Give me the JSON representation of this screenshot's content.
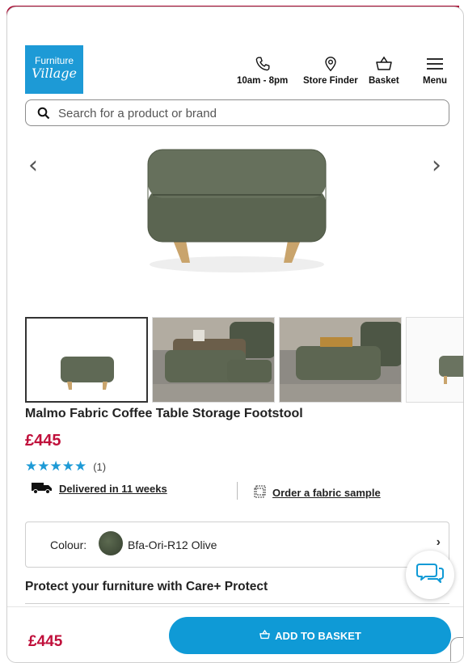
{
  "header": {
    "logo_line1": "Furniture",
    "logo_line2": "Village",
    "hours_label": "10am - 8pm",
    "store_finder_label": "Store Finder",
    "basket_label": "Basket",
    "menu_label": "Menu"
  },
  "search": {
    "placeholder": "Search for a product or brand"
  },
  "gallery": {
    "prev_icon": "‹",
    "next_icon": "›"
  },
  "product": {
    "title": "Malmo Fabric Coffee Table Storage Footstool",
    "price": "£445",
    "rating_stars": "★★★★★",
    "rating_count": "(1)",
    "delivery_text": "Delivered in 11 weeks",
    "sample_text": "Order a fabric sample"
  },
  "colour": {
    "label": "Colour:",
    "value": "Bfa-Ori-R12 Olive",
    "swatch_color": "#4a5640"
  },
  "protect": {
    "heading": "Protect your furniture with Care+ Protect"
  },
  "bottom": {
    "price": "£445",
    "add_button": "ADD TO BASKET"
  },
  "colors": {
    "promo": "#a80a32",
    "brand_blue": "#1d9ad6",
    "price_red": "#c0103b",
    "button_blue": "#0f9ad6"
  }
}
